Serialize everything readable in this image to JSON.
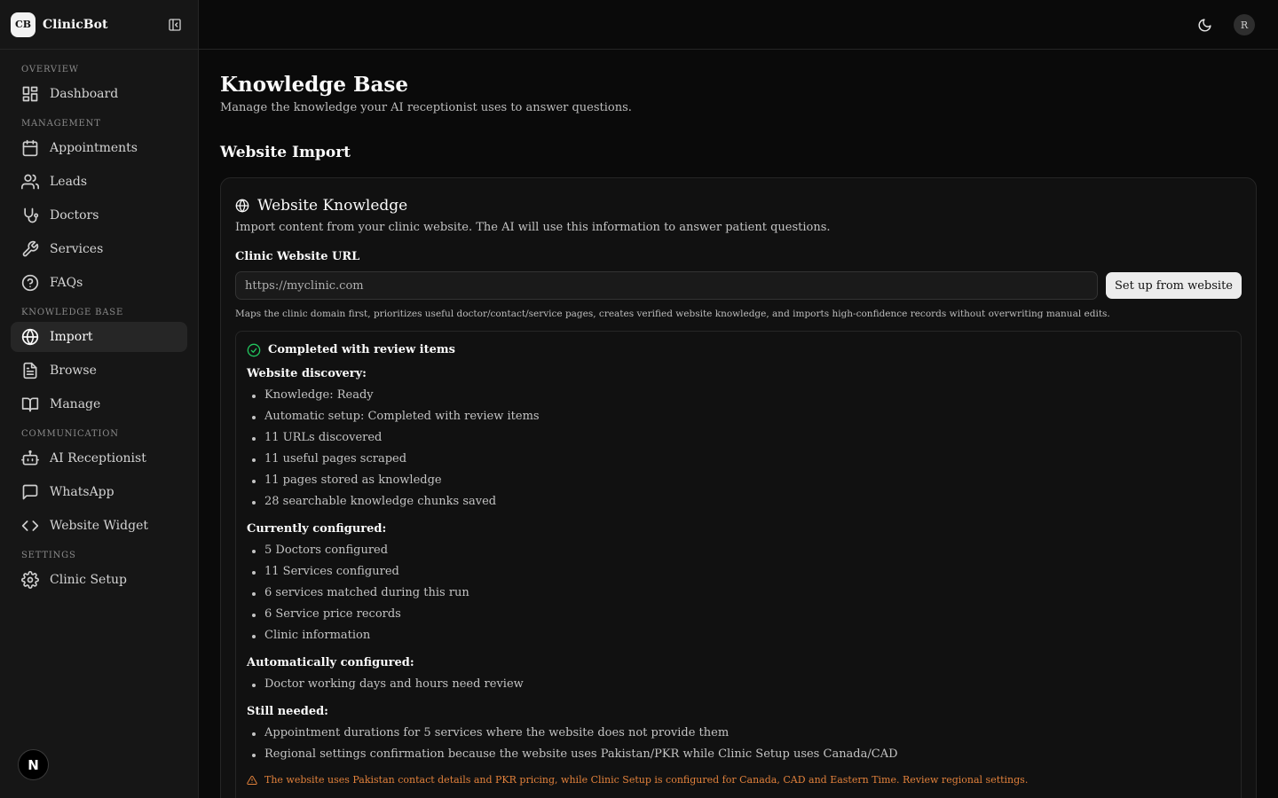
{
  "brand": {
    "logo": "CB",
    "name": "ClinicBot"
  },
  "sidebar": {
    "sections": [
      {
        "label": "OVERVIEW",
        "items": [
          {
            "label": "Dashboard",
            "icon": "grid-icon"
          }
        ]
      },
      {
        "label": "MANAGEMENT",
        "items": [
          {
            "label": "Appointments",
            "icon": "calendar-icon"
          },
          {
            "label": "Leads",
            "icon": "users-icon"
          },
          {
            "label": "Doctors",
            "icon": "stethoscope-icon"
          },
          {
            "label": "Services",
            "icon": "wrench-icon"
          },
          {
            "label": "FAQs",
            "icon": "help-circle-icon"
          }
        ]
      },
      {
        "label": "KNOWLEDGE BASE",
        "items": [
          {
            "label": "Import",
            "icon": "globe-icon",
            "active": true
          },
          {
            "label": "Browse",
            "icon": "file-text-icon"
          },
          {
            "label": "Manage",
            "icon": "book-icon"
          }
        ]
      },
      {
        "label": "COMMUNICATION",
        "items": [
          {
            "label": "AI Receptionist",
            "icon": "bot-icon"
          },
          {
            "label": "WhatsApp",
            "icon": "message-square-icon"
          },
          {
            "label": "Website Widget",
            "icon": "code-icon"
          }
        ]
      },
      {
        "label": "SETTINGS",
        "items": [
          {
            "label": "Clinic Setup",
            "icon": "gear-icon"
          }
        ]
      }
    ],
    "footer_badge": "N"
  },
  "topbar": {
    "avatar": "R"
  },
  "page": {
    "title": "Knowledge Base",
    "subtitle": "Manage the knowledge your AI receptionist uses to answer questions.",
    "section_title": "Website Import"
  },
  "card": {
    "title": "Website Knowledge",
    "description": "Import content from your clinic website. The AI will use this information to answer patient questions.",
    "field_label": "Clinic Website URL",
    "url_placeholder": "https://myclinic.com",
    "url_value": "",
    "button_label": "Set up from website",
    "help_text": "Maps the clinic domain first, prioritizes useful doctor/contact/service pages, creates verified website knowledge, and imports high-confidence records without overwriting manual edits."
  },
  "status": {
    "title": "Completed with review items",
    "groups": [
      {
        "title": "Website discovery:",
        "items": [
          "Knowledge: Ready",
          "Automatic setup: Completed with review items",
          "11 URLs discovered",
          "11 useful pages scraped",
          "11 pages stored as knowledge",
          "28 searchable knowledge chunks saved"
        ]
      },
      {
        "title": "Currently configured:",
        "items": [
          "5 Doctors configured",
          "11 Services configured",
          "6 services matched during this run",
          "6 Service price records",
          "Clinic information"
        ]
      },
      {
        "title": "Automatically configured:",
        "items": [
          "Doctor working days and hours need review"
        ]
      },
      {
        "title": "Still needed:",
        "items": [
          "Appointment durations for 5 services where the website does not provide them",
          "Regional settings confirmation because the website uses Pakistan/PKR while Clinic Setup uses Canada/CAD"
        ]
      }
    ],
    "warning": "The website uses Pakistan contact details and PKR pricing, while Clinic Setup is configured for Canada, CAD and Eastern Time. Review regional settings."
  },
  "colors": {
    "accent_success": "#22c55e",
    "warning": "#e0803b",
    "background": "#0a0a0a",
    "sidebar": "#161616"
  }
}
